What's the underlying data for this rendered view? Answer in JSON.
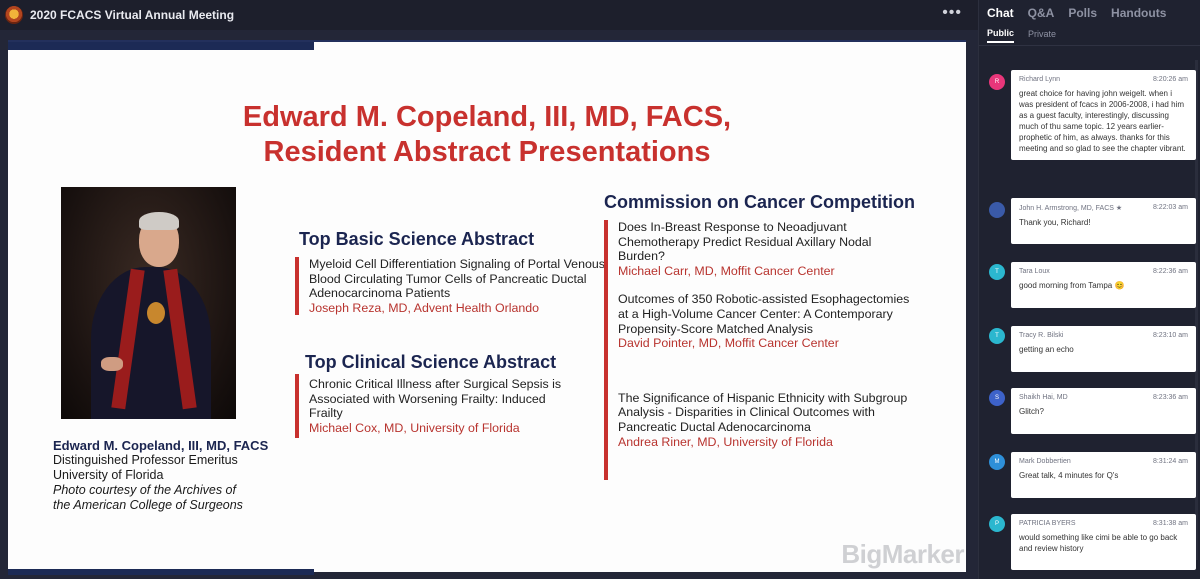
{
  "window": {
    "title": "2020 FCACS Virtual Annual Meeting",
    "menu_icon": "more-dots-icon"
  },
  "slide": {
    "title_line1": "Edward M. Copeland, III, MD, FACS,",
    "title_line2": "Resident Abstract Presentations",
    "caption": {
      "name": "Edward M. Copeland, III, MD, FACS",
      "line1": "Distinguished Professor Emeritus",
      "line2": "University of Florida",
      "line3": "Photo courtesy of the Archives of",
      "line4": "the American College of Surgeons"
    },
    "basic": {
      "heading": "Top Basic Science Abstract",
      "title": "Myeloid Cell Differentiation Signaling of Portal Venous Blood Circulating Tumor Cells of Pancreatic Ductal Adenocarcinoma Patients",
      "author": "Joseph Reza, MD, Advent Health Orlando"
    },
    "clinical": {
      "heading": "Top Clinical Science Abstract",
      "title": "Chronic Critical Illness after Surgical Sepsis is Associated with Worsening Frailty: Induced Frailty",
      "author": "Michael Cox, MD, University of Florida"
    },
    "commission": {
      "heading": "Commission on Cancer Competition",
      "items": [
        {
          "title": "Does In-Breast Response to Neoadjuvant Chemotherapy Predict Residual Axillary Nodal Burden?",
          "author": "Michael Carr, MD, Moffit Cancer Center"
        },
        {
          "title": "Outcomes of 350 Robotic-assisted Esophagectomies at a High-Volume Cancer Center: A Contemporary Propensity-Score Matched Analysis",
          "author": "David Pointer, MD, Moffit Cancer Center"
        },
        {
          "title": "The Significance of Hispanic Ethnicity with Subgroup Analysis - Disparities in Clinical Outcomes with Pancreatic Ductal Adenocarcinoma",
          "author": "Andrea Riner, MD, University of Florida"
        }
      ]
    },
    "watermark": "BigMarker"
  },
  "chat": {
    "tabs": [
      "Chat",
      "Q&A",
      "Polls",
      "Handouts"
    ],
    "subtabs": [
      "Public",
      "Private"
    ],
    "messages": [
      {
        "avatar": "R",
        "avatar_color": "#e8367a",
        "name": "Richard Lynn",
        "time": "8:20:26 am",
        "text": "great choice for having john weigelt. when i was president of fcacs in 2006-2008, i had him as a guest faculty, interestingly, discussing much of thu same topic. 12 years earlier-prophetic of him, as always. thanks for this meeting and so glad to see the chapter vibrant."
      },
      {
        "avatar": "",
        "avatar_color": "#3a5aa8",
        "name": "John H. Armstrong, MD, FACS ★",
        "time": "8:22:03 am",
        "text": "Thank you, Richard!"
      },
      {
        "avatar": "T",
        "avatar_color": "#2bb7cf",
        "name": "Tara Loux",
        "time": "8:22:36 am",
        "text": "good morning from Tampa 😊"
      },
      {
        "avatar": "T",
        "avatar_color": "#2bb7cf",
        "name": "Tracy R. Bilski",
        "time": "8:23:10 am",
        "text": "getting an echo"
      },
      {
        "avatar": "S",
        "avatar_color": "#3d62c9",
        "name": "Shaikh Hai, MD",
        "time": "8:23:36 am",
        "text": "Glitch?"
      },
      {
        "avatar": "M",
        "avatar_color": "#2e8fd8",
        "name": "Mark Dobbertien",
        "time": "8:31:24 am",
        "text": "Great talk, 4 minutes for Q's"
      },
      {
        "avatar": "P",
        "avatar_color": "#2bb7cf",
        "name": "PATRICIA BYERS",
        "time": "8:31:38 am",
        "text": "would something like cimi be able to go back and review history"
      }
    ]
  }
}
